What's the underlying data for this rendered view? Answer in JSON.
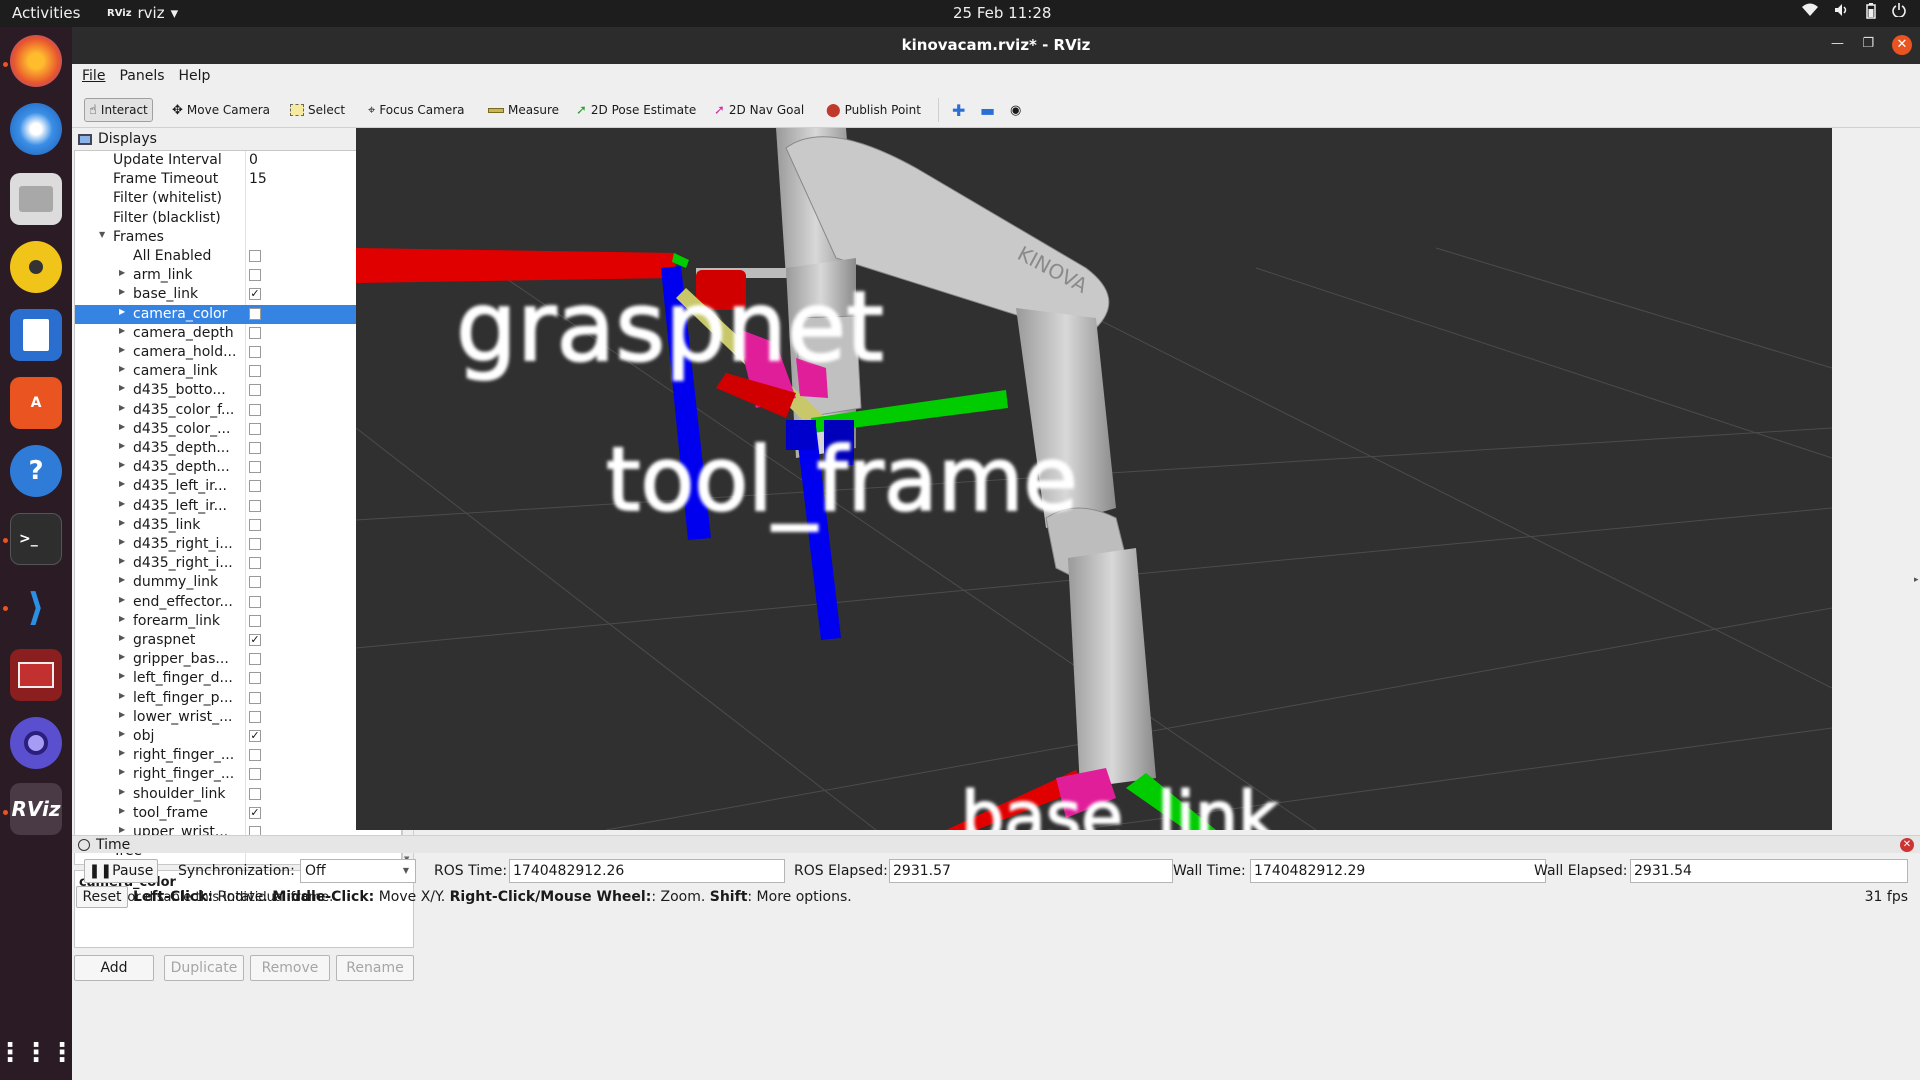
{
  "topbar": {
    "activities": "Activities",
    "app_name": "rviz",
    "app_icon": "RViz",
    "datetime": "25 Feb  11:28",
    "tray_icons": [
      "wifi-icon",
      "volume-icon",
      "battery-icon",
      "power-icon"
    ]
  },
  "dock": {
    "items": [
      "firefox",
      "thunderbird",
      "files",
      "rhythmbox",
      "writer",
      "app-center",
      "help",
      "terminal",
      "vscode",
      "workspace-app",
      "screenshot-camera",
      "rviz",
      "show-apps"
    ],
    "rviz_label": "RViz"
  },
  "window": {
    "title": "kinovacam.rviz* - RViz"
  },
  "menu": {
    "file": "File",
    "panels": "Panels",
    "help": "Help"
  },
  "toolbar": {
    "interact": "Interact",
    "move_camera": "Move Camera",
    "select": "Select",
    "focus_camera": "Focus Camera",
    "measure": "Measure",
    "pose_estimate": "2D Pose Estimate",
    "nav_goal": "2D Nav Goal",
    "publish_point": "Publish Point"
  },
  "displays": {
    "title": "Displays",
    "rows": [
      {
        "label": "Update Interval",
        "value": "0"
      },
      {
        "label": "Frame Timeout",
        "value": "15"
      },
      {
        "label": "Filter (whitelist)",
        "value": ""
      },
      {
        "label": "Filter (blacklist)",
        "value": ""
      },
      {
        "label": "Frames"
      },
      {
        "label": "All Enabled",
        "checked": false
      },
      {
        "label": "arm_link",
        "checked": false
      },
      {
        "label": "base_link",
        "checked": true
      },
      {
        "label": "camera_color",
        "checked": false,
        "selected": true
      },
      {
        "label": "camera_depth",
        "checked": false
      },
      {
        "label": "camera_hold...",
        "checked": false
      },
      {
        "label": "camera_link",
        "checked": false
      },
      {
        "label": "d435_botto...",
        "checked": false
      },
      {
        "label": "d435_color_f...",
        "checked": false
      },
      {
        "label": "d435_color_...",
        "checked": false
      },
      {
        "label": "d435_depth...",
        "checked": false
      },
      {
        "label": "d435_depth...",
        "checked": false
      },
      {
        "label": "d435_left_ir...",
        "checked": false
      },
      {
        "label": "d435_left_ir...",
        "checked": false
      },
      {
        "label": "d435_link",
        "checked": false
      },
      {
        "label": "d435_right_i...",
        "checked": false
      },
      {
        "label": "d435_right_i...",
        "checked": false
      },
      {
        "label": "dummy_link",
        "checked": false
      },
      {
        "label": "end_effector...",
        "checked": false
      },
      {
        "label": "forearm_link",
        "checked": false
      },
      {
        "label": "graspnet",
        "checked": true
      },
      {
        "label": "gripper_bas...",
        "checked": false
      },
      {
        "label": "left_finger_d...",
        "checked": false
      },
      {
        "label": "left_finger_p...",
        "checked": false
      },
      {
        "label": "lower_wrist_...",
        "checked": false
      },
      {
        "label": "obj",
        "checked": true
      },
      {
        "label": "right_finger_...",
        "checked": false
      },
      {
        "label": "right_finger_...",
        "checked": false
      },
      {
        "label": "shoulder_link",
        "checked": false
      },
      {
        "label": "tool_frame",
        "checked": true
      },
      {
        "label": "upper_wrist...",
        "checked": false
      },
      {
        "label": "Tree"
      }
    ],
    "description_title": "camera_color",
    "description_text": "Enable or disable this individual frame.",
    "buttons": {
      "add": "Add",
      "duplicate": "Duplicate",
      "remove": "Remove",
      "rename": "Rename"
    }
  },
  "viewport": {
    "frame_labels": [
      "graspnet",
      "tool_frame",
      "base_link"
    ],
    "robot_brand": "KINOVA",
    "axis_colors": {
      "x": "#ff0000",
      "y": "#00cc00",
      "z": "#0000ff"
    },
    "background": "#303030"
  },
  "time": {
    "title": "Time",
    "pause": "Pause",
    "sync_label": "Synchronization:",
    "sync_value": "Off",
    "ros_time_label": "ROS Time:",
    "ros_time": "1740482912.26",
    "ros_elapsed_label": "ROS Elapsed:",
    "ros_elapsed": "2931.57",
    "wall_time_label": "Wall Time:",
    "wall_time": "1740482912.29",
    "wall_elapsed_label": "Wall Elapsed:",
    "wall_elapsed": "2931.54"
  },
  "status": {
    "reset": "Reset",
    "hint_left_key": "Left-Click:",
    "hint_left": " Rotate. ",
    "hint_middle_key": "Middle-Click:",
    "hint_middle": " Move X/Y. ",
    "hint_right_key": "Right-Click/Mouse Wheel:",
    "hint_right": ": Zoom. ",
    "hint_shift_key": "Shift",
    "hint_shift": ": More options.",
    "fps": "31 fps"
  }
}
